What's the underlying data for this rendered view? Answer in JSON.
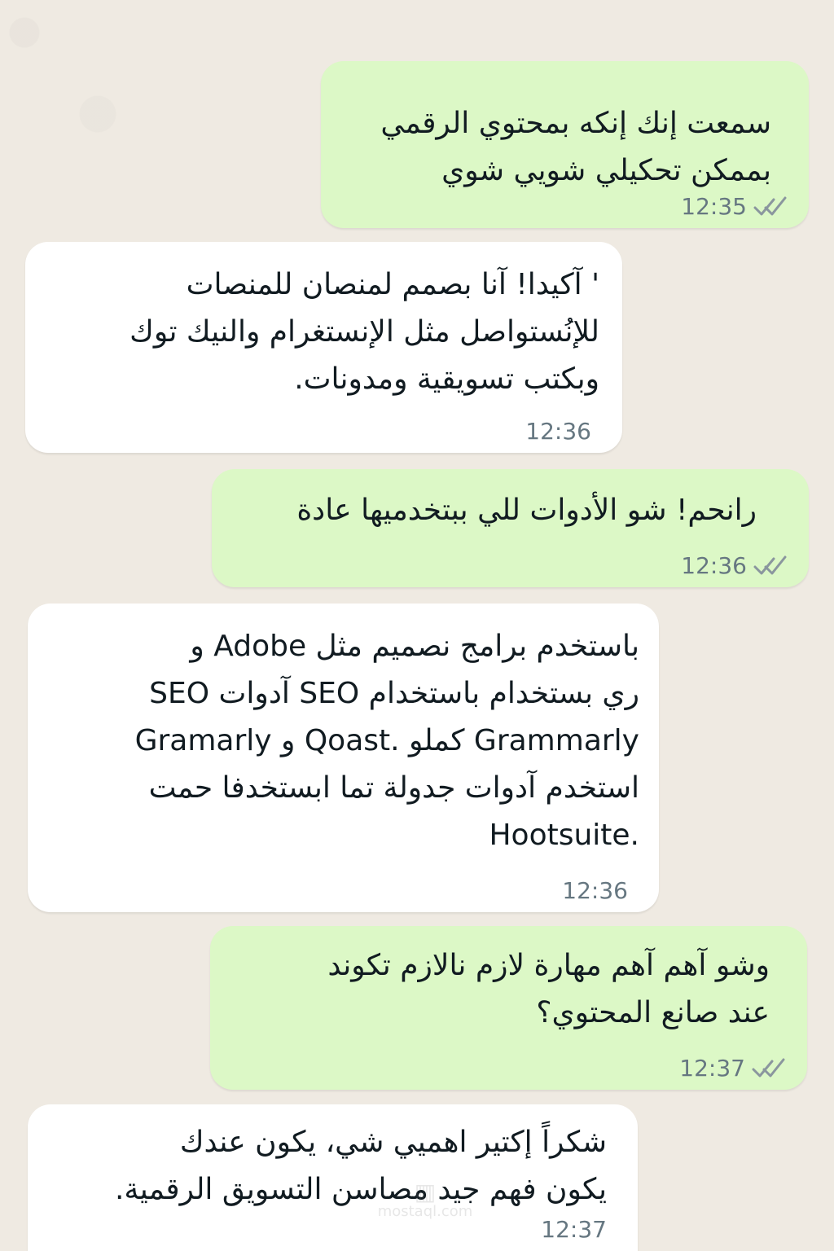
{
  "messages": [
    {
      "id": "m1",
      "direction": "outgoing",
      "text": "سمعت إنك إنكه بمحتوي الرقمي\nبممكن تحكيلي شويي شوي",
      "time": "12:35",
      "status_icon": "double-check-icon"
    },
    {
      "id": "m2",
      "direction": "incoming",
      "text": "' آكيدا! آنا بصمم لمنصان للمنصات\nللإنُستواصل مثل الإنستغرام والنيك توك\nوبكتب تسويقية ومدونات.",
      "time": "12:36"
    },
    {
      "id": "m3",
      "direction": "outgoing",
      "text": "رانحم! شو الأدوات للي ببتخدميها عادة",
      "time": "12:36",
      "status_icon": "double-check-icon"
    },
    {
      "id": "m4",
      "direction": "incoming",
      "text": "باستخدم برامج نصميم مثل Adobe  و\nري بستخدام باستخدام SEO آدوات SEO\nGramarly و Qoast. كملو Grammarly\nاستخدم آدوات جدولة تما ابستخدفا حمت\nHootsuite.",
      "time": "12:36"
    },
    {
      "id": "m5",
      "direction": "outgoing",
      "text": "وشو آهم آهم مهارة لازم نالازم تكوند\nعند صانع المحتوي؟",
      "time": "12:37",
      "status_icon": "double-check-icon"
    },
    {
      "id": "m6",
      "direction": "incoming",
      "text": "شكراً إكتير اهميي شي، يكون عندك\nيكون فهم جيد مصاسن التسويق الرقمية.",
      "time": "12:37"
    }
  ],
  "watermark": {
    "logo_icon": "mostaql-logo-icon",
    "text": "mostaql.com"
  },
  "colors": {
    "outgoing_bubble": "#dcf8c6",
    "incoming_bubble": "#ffffff",
    "background": "#efeae2",
    "meta_text": "#667781"
  }
}
